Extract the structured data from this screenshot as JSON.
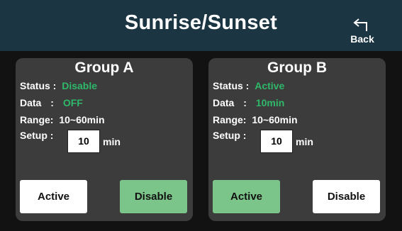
{
  "header": {
    "title": "Sunrise/Sunset",
    "back_label": "Back",
    "back_icon": "return-arrow-icon"
  },
  "colors": {
    "header_bg": "#1c3542",
    "panel_bg": "#3c3c3c",
    "status_text": "#2fb86a",
    "selected_button": "#7cc58a",
    "unselected_button": "#ffffff"
  },
  "groups": [
    {
      "title": "Group A",
      "status_label": "Status :",
      "status_value": "Disable",
      "data_label": "Data",
      "data_colon": ":",
      "data_value": "OFF",
      "range_label": "Range:",
      "range_value": "10~60min",
      "setup_label": "Setup :",
      "setup_value": "10",
      "setup_unit": "min",
      "active_label": "Active",
      "disable_label": "Disable",
      "selected": "Disable"
    },
    {
      "title": "Group B",
      "status_label": "Status :",
      "status_value": "Active",
      "data_label": "Data",
      "data_colon": ":",
      "data_value": "10min",
      "range_label": "Range:",
      "range_value": "10~60min",
      "setup_label": "Setup :",
      "setup_value": "10",
      "setup_unit": "min",
      "active_label": "Active",
      "disable_label": "Disable",
      "selected": "Active"
    }
  ]
}
